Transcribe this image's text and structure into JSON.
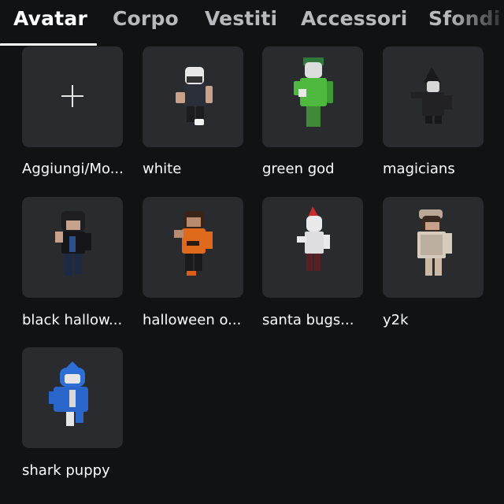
{
  "tabs": [
    {
      "label": "Avatar",
      "active": true
    },
    {
      "label": "Corpo",
      "active": false
    },
    {
      "label": "Vestiti",
      "active": false
    },
    {
      "label": "Accessori",
      "active": false
    },
    {
      "label": "Sfondi",
      "active": false
    }
  ],
  "grid": {
    "items": [
      {
        "label": "Aggiungi/Mo...",
        "icon": "plus-icon"
      },
      {
        "label": "white",
        "icon": "avatar-thumbnail"
      },
      {
        "label": "green god",
        "icon": "avatar-thumbnail"
      },
      {
        "label": "magicians",
        "icon": "avatar-thumbnail"
      },
      {
        "label": "black hallow...",
        "icon": "avatar-thumbnail"
      },
      {
        "label": "halloween o...",
        "icon": "avatar-thumbnail"
      },
      {
        "label": "santa bugs...",
        "icon": "avatar-thumbnail"
      },
      {
        "label": "y2k",
        "icon": "avatar-thumbnail"
      },
      {
        "label": "shark puppy",
        "icon": "avatar-thumbnail"
      }
    ]
  },
  "colors": {
    "background": "#111214",
    "tile": "#2a2b2f",
    "active_tab": "#ffffff",
    "inactive_tab": "#b8b9bd"
  }
}
